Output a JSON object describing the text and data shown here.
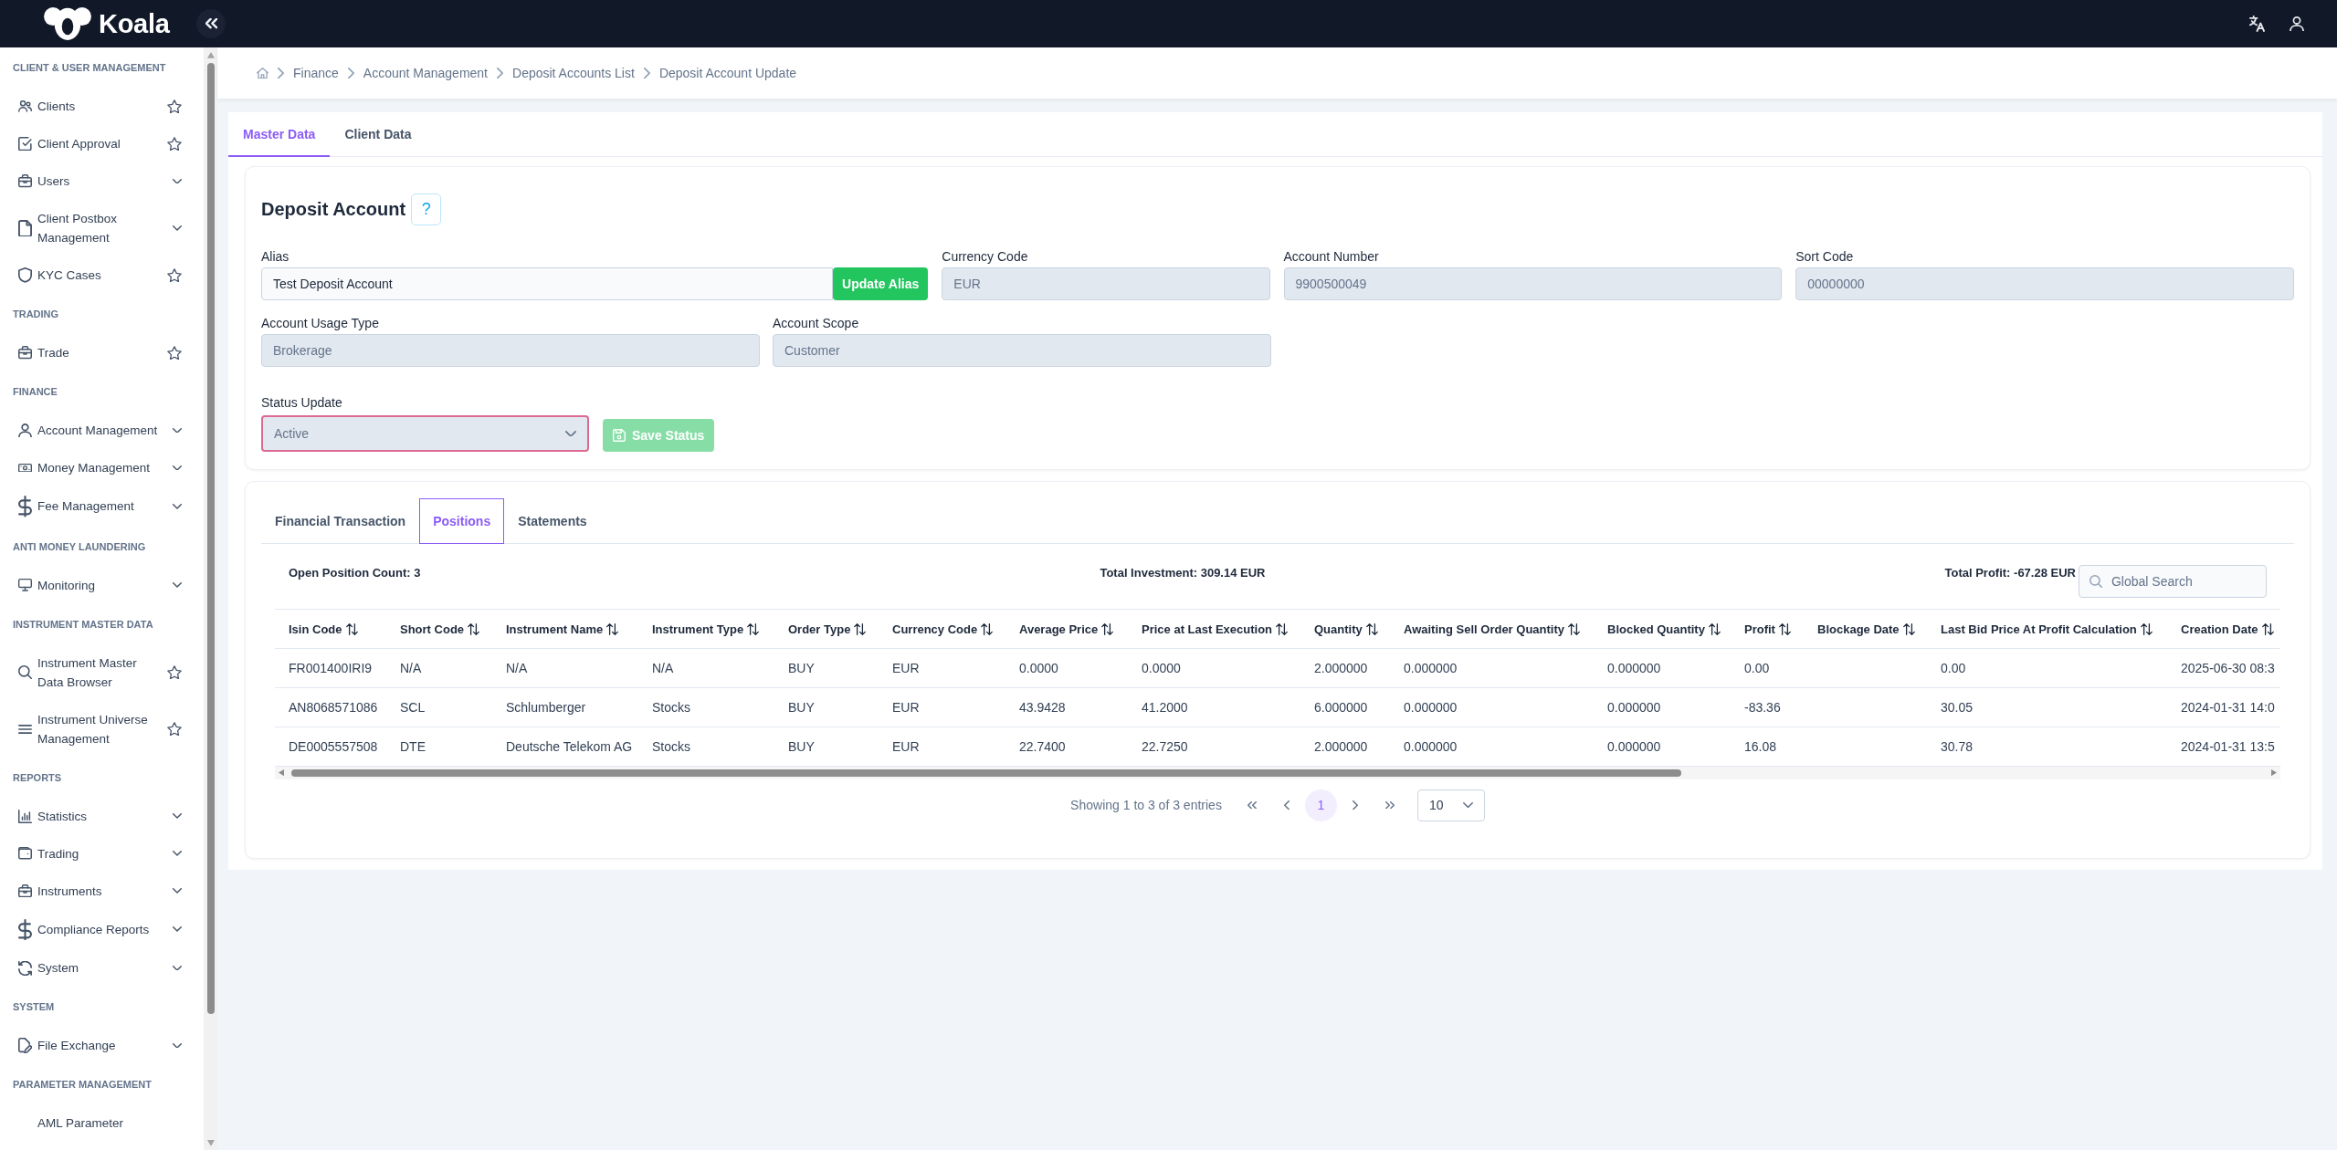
{
  "top_bar": {
    "logo": "Koala"
  },
  "sidebar": {
    "sections": [
      {
        "title": "CLIENT & USER MANAGEMENT",
        "items": [
          {
            "label": "Clients",
            "kind": "link",
            "favorite": false
          },
          {
            "label": "Client Approval",
            "kind": "link",
            "favorite": false
          },
          {
            "label": "Users",
            "kind": "group",
            "expanded": false
          },
          {
            "label": "Client Postbox Management",
            "kind": "group",
            "expanded": false
          },
          {
            "label": "KYC Cases",
            "kind": "link",
            "favorite": false
          }
        ]
      },
      {
        "title": "TRADING",
        "items": [
          {
            "label": "Trade",
            "kind": "link",
            "favorite": false
          }
        ]
      },
      {
        "title": "FINANCE",
        "items": [
          {
            "label": "Account Management",
            "kind": "group",
            "expanded": false
          },
          {
            "label": "Money Management",
            "kind": "group",
            "expanded": false
          },
          {
            "label": "Fee Management",
            "kind": "group",
            "expanded": false
          }
        ]
      },
      {
        "title": "ANTI MONEY LAUNDERING",
        "items": [
          {
            "label": "Monitoring",
            "kind": "group",
            "expanded": false
          }
        ]
      },
      {
        "title": "INSTRUMENT MASTER DATA",
        "items": [
          {
            "label": "Instrument Master Data Browser",
            "kind": "link",
            "favorite": false
          },
          {
            "label": "Instrument Universe Management",
            "kind": "link",
            "favorite": false
          }
        ]
      },
      {
        "title": "REPORTS",
        "items": [
          {
            "label": "Statistics",
            "kind": "group",
            "expanded": false
          },
          {
            "label": "Trading",
            "kind": "group",
            "expanded": false
          },
          {
            "label": "Instruments",
            "kind": "group",
            "expanded": false
          },
          {
            "label": "Compliance Reports",
            "kind": "group",
            "expanded": false
          },
          {
            "label": "System",
            "kind": "group",
            "expanded": false
          }
        ]
      },
      {
        "title": "SYSTEM",
        "items": [
          {
            "label": "File Exchange",
            "kind": "group",
            "expanded": false
          }
        ]
      },
      {
        "title": "PARAMETER MANAGEMENT",
        "items": [
          {
            "label": "AML Parameter",
            "kind": "plain"
          }
        ]
      }
    ]
  },
  "breadcrumb": [
    "Finance",
    "Account Management",
    "Deposit Accounts List",
    "Deposit Account Update"
  ],
  "tabs": [
    {
      "label": "Master Data",
      "selected": true
    },
    {
      "label": "Client Data",
      "selected": false
    }
  ],
  "deposit_account": {
    "title": "Deposit Account",
    "help": "?",
    "fields": [
      {
        "label": "Alias",
        "value": "Test Deposit Account",
        "disabled": false,
        "button": "Update Alias"
      },
      {
        "label": "Currency Code",
        "value": "EUR",
        "disabled": true
      },
      {
        "label": "Account Number",
        "value": "9900500049",
        "disabled": true
      },
      {
        "label": "Sort Code",
        "value": "00000000",
        "disabled": true
      },
      {
        "label": "Account Usage Type",
        "value": "Brokerage",
        "disabled": true
      },
      {
        "label": "Account Scope",
        "value": "Customer",
        "disabled": true
      }
    ],
    "status": {
      "label": "Status Update",
      "value": "Active",
      "invalid": true,
      "disabled": true
    },
    "save_button": {
      "label": "Save Status",
      "disabled": true
    }
  },
  "positions": {
    "tabs": [
      {
        "label": "Financial Transaction",
        "selected": false
      },
      {
        "label": "Positions",
        "selected": true
      },
      {
        "label": "Statements",
        "selected": false
      }
    ],
    "summary": [
      "Open Position Count: 3",
      "Total Investment: 309.14 EUR",
      "Total Profit: -67.28 EUR"
    ],
    "search": {
      "placeholder": "Global Search"
    },
    "table": {
      "columns": [
        {
          "label": "Isin Code",
          "sortable": true
        },
        {
          "label": "Short Code",
          "sortable": true
        },
        {
          "label": "Instrument Name",
          "sortable": true
        },
        {
          "label": "Instrument Type",
          "sortable": true
        },
        {
          "label": "Order Type",
          "sortable": true
        },
        {
          "label": "Currency Code",
          "sortable": true
        },
        {
          "label": "Average Price",
          "sortable": true
        },
        {
          "label": "Price at Last Execution",
          "sortable": true
        },
        {
          "label": "Quantity",
          "sortable": true
        },
        {
          "label": "Awaiting Sell Order Quantity",
          "sortable": true
        },
        {
          "label": "Blocked Quantity",
          "sortable": true
        },
        {
          "label": "Profit",
          "sortable": true
        },
        {
          "label": "Blockage Date",
          "sortable": true
        },
        {
          "label": "Last Bid Price At Profit Calculation",
          "sortable": true
        },
        {
          "label": "Creation Date",
          "sortable": true
        }
      ],
      "rows": [
        [
          "FR001400IRI9",
          "N/A",
          "N/A",
          "N/A",
          "BUY",
          "EUR",
          "0.0000",
          "0.0000",
          "2.000000",
          "0.000000",
          "0.000000",
          "0.00",
          null,
          "0.00",
          "2025-06-30 08:3"
        ],
        [
          "AN8068571086",
          "SCL",
          "Schlumberger",
          "Stocks",
          "BUY",
          "EUR",
          "43.9428",
          "41.2000",
          "6.000000",
          "0.000000",
          "0.000000",
          "-83.36",
          null,
          "30.05",
          "2024-01-31 14:0"
        ],
        [
          "DE0005557508",
          "DTE",
          "Deutsche Telekom AG",
          "Stocks",
          "BUY",
          "EUR",
          "22.7400",
          "22.7250",
          "2.000000",
          "0.000000",
          "0.000000",
          "16.08",
          null,
          "30.78",
          "2024-01-31 13:5"
        ]
      ]
    },
    "pagination": {
      "info": "Showing 1 to 3 of 3 entries",
      "pages": [
        {
          "label": "1",
          "selected": true
        }
      ],
      "page_size": "10"
    }
  }
}
